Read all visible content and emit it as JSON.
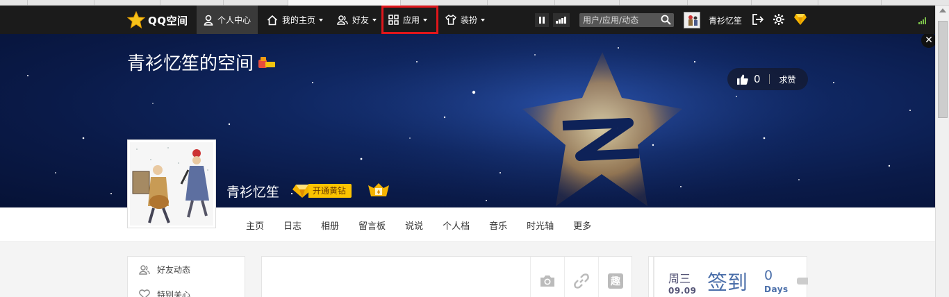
{
  "topnav": {
    "logo_text": "QQ空间",
    "items": [
      {
        "label": "个人中心",
        "icon": "person-icon"
      },
      {
        "label": "我的主页",
        "icon": "home-icon"
      },
      {
        "label": "好友",
        "icon": "friends-icon"
      },
      {
        "label": "应用",
        "icon": "apps-grid-icon"
      },
      {
        "label": "装扮",
        "icon": "tshirt-icon"
      }
    ],
    "search_placeholder": "用户/应用/动态",
    "username": "青衫忆笙"
  },
  "banner": {
    "space_title": "青衫忆笙的空间",
    "like_count": "0",
    "ask_like_label": "求赞",
    "profile_name": "青衫忆笙",
    "vip_button_label": "开通黄钻"
  },
  "subnav": {
    "items": [
      "主页",
      "日志",
      "相册",
      "留言板",
      "说说",
      "个人档",
      "音乐",
      "时光轴",
      "更多"
    ]
  },
  "sidebar": {
    "items": [
      "好友动态",
      "特别关心"
    ]
  },
  "composer": {
    "buttons": [
      "camera-icon",
      "link-icon",
      "fun-icon"
    ],
    "fun_label": "趣"
  },
  "signin": {
    "weekday": "周三",
    "date": "09.09",
    "sign_label": "签到",
    "count": "0",
    "unit": "Days"
  },
  "colors": {
    "nav_bg": "#1b1b1b",
    "highlight": "#e0161b",
    "vip_yellow": "#fcc300",
    "accent_blue": "#4a6ea9"
  }
}
